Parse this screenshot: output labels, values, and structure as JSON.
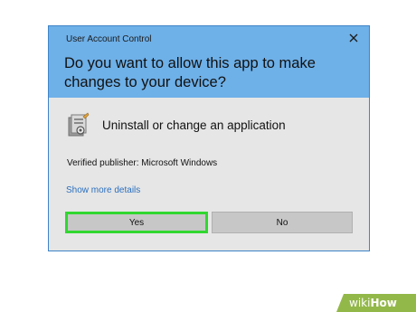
{
  "dialog": {
    "title": "User Account Control",
    "question": "Do you want to allow this app to make changes to your device?",
    "app_name": "Uninstall or change an application",
    "publisher": "Verified publisher: Microsoft Windows",
    "more_details": "Show more details",
    "yes_label": "Yes",
    "no_label": "No",
    "close_icon": "close-icon",
    "app_icon": "control-panel-icon"
  },
  "watermark": {
    "prefix": "wiki",
    "suffix": "How"
  },
  "colors": {
    "header": "#6eb0e8",
    "body": "#e6e6e6",
    "button": "#c7c7c7",
    "highlight": "#31d731",
    "link": "#2b6fbe",
    "watermark": "#93b84a"
  }
}
